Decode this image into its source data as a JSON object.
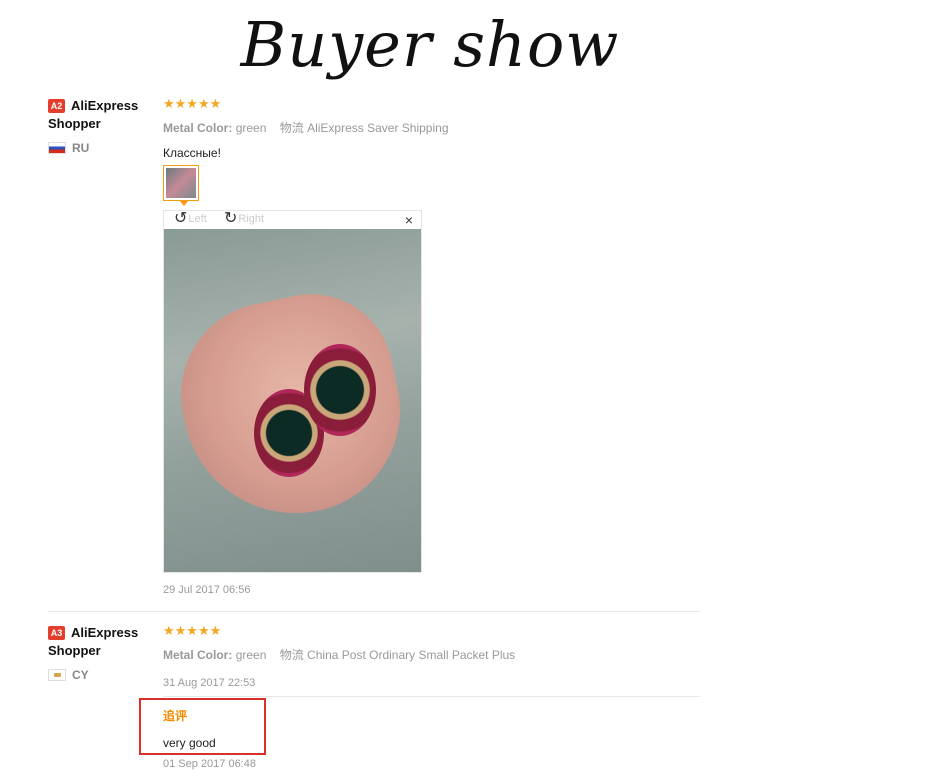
{
  "banner": {
    "title": "Buyer show"
  },
  "reviews": [
    {
      "badge": "A2",
      "username": "AliExpress Shopper",
      "country": "RU",
      "stars": "★★★★★",
      "attr_label": "Metal Color:",
      "attr_value": "green",
      "shipping_label": "物流",
      "shipping_value": "AliExpress Saver Shipping",
      "feedback": "Классные!",
      "viewer": {
        "left_label": "Left",
        "right_label": "Right",
        "close": "×"
      },
      "date": "29 Jul 2017 06:56"
    },
    {
      "badge": "A3",
      "username": "AliExpress Shopper",
      "country": "CY",
      "stars": "★★★★★",
      "attr_label": "Metal Color:",
      "attr_value": "green",
      "shipping_label": "物流",
      "shipping_value": "China Post Ordinary Small Packet Plus",
      "date": "31 Aug 2017 22:53",
      "append": {
        "title": "追评",
        "text": "very good",
        "date": "01 Sep 2017 06:48"
      }
    }
  ],
  "colors": {
    "accent": "#f5a623",
    "badge": "#e43f2c",
    "highlight": "#d9302a"
  },
  "icons": [
    "rotate-left-icon",
    "rotate-right-icon",
    "close-icon",
    "star-icon",
    "flag-ru-icon",
    "flag-cy-icon"
  ]
}
